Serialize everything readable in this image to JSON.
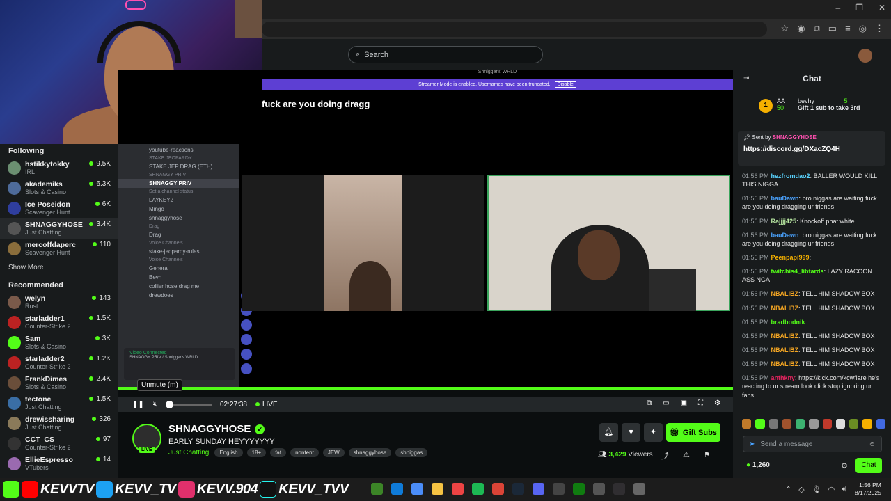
{
  "search": {
    "placeholder": "Search"
  },
  "sidebar": {
    "following_title": "Following",
    "following": [
      {
        "name": "hstikkytokky",
        "category": "IRL",
        "viewers": "9.5K",
        "color": "#6b8f71"
      },
      {
        "name": "akademiks",
        "category": "Slots & Casino",
        "viewers": "6.3K",
        "color": "#4e6b9a"
      },
      {
        "name": "Ice Poseidon",
        "category": "Scavenger Hunt",
        "viewers": "6K",
        "color": "#2f3e9e"
      },
      {
        "name": "SHNAGGYHOSE",
        "category": "Just Chatting",
        "viewers": "3.4K",
        "color": "#555"
      },
      {
        "name": "mercoffdaperc",
        "category": "Scavenger Hunt",
        "viewers": "110",
        "color": "#8a6d3b"
      }
    ],
    "show_more": "Show More",
    "recommended_title": "Recommended",
    "recommended": [
      {
        "name": "welyn",
        "category": "Rust",
        "viewers": "143",
        "color": "#7a5a4a"
      },
      {
        "name": "starladder1",
        "category": "Counter-Strike 2",
        "viewers": "1.5K",
        "color": "#b22"
      },
      {
        "name": "Sam",
        "category": "Slots & Casino",
        "viewers": "3K",
        "color": "#53fc18"
      },
      {
        "name": "starladder2",
        "category": "Counter-Strike 2",
        "viewers": "1.2K",
        "color": "#b22"
      },
      {
        "name": "FrankDimes",
        "category": "Slots & Casino",
        "viewers": "2.4K",
        "color": "#6a4e3a"
      },
      {
        "name": "tectone",
        "category": "Just Chatting",
        "viewers": "1.5K",
        "color": "#3a6ea5"
      },
      {
        "name": "drewissharing",
        "category": "Just Chatting",
        "viewers": "326",
        "color": "#8a7a5a"
      },
      {
        "name": "CCT_CS",
        "category": "Counter-Strike 2",
        "viewers": "97",
        "color": "#333"
      },
      {
        "name": "EllieEspresso",
        "category": "VTubers",
        "viewers": "14",
        "color": "#9a6ab0"
      }
    ]
  },
  "discord": {
    "window_title": "Shnigger's WRLD",
    "streamer_mode": "Streamer Mode is enabled. Usernames have been truncated.",
    "disable": "Disable",
    "channels": [
      {
        "text": "youtube-reactions",
        "kind": "channel"
      },
      {
        "text": "STAKE JEOPARDY",
        "kind": "cat"
      },
      {
        "text": "STAKE JEP DRAG (ETH)",
        "kind": "channel"
      },
      {
        "text": "SHNAGGY PRIV",
        "kind": "cat"
      },
      {
        "text": "SHNAGGY PRIV",
        "kind": "hl"
      },
      {
        "text": "Set a channel status",
        "kind": "cat"
      },
      {
        "text": "LAYKEY2",
        "kind": "channel"
      },
      {
        "text": "Mingo",
        "kind": "channel"
      },
      {
        "text": "shnaggyhose",
        "kind": "channel"
      },
      {
        "text": "Drag",
        "kind": "cat"
      },
      {
        "text": "Drag",
        "kind": "channel"
      },
      {
        "text": "Voice Channels",
        "kind": "cat"
      },
      {
        "text": "stake-jeopardy-rules",
        "kind": "channel"
      },
      {
        "text": "Voice Channels",
        "kind": "cat"
      },
      {
        "text": "General",
        "kind": "channel"
      },
      {
        "text": "Bevh",
        "kind": "channel"
      },
      {
        "text": "collier hose drag me",
        "kind": "channel"
      },
      {
        "text": "drewdoes",
        "kind": "channel"
      }
    ],
    "voice_status": "Video Connected",
    "voice_sub": "SHNAGGY PRIV / Shnigger's WRLD"
  },
  "video": {
    "caption": "fuck are you doing dragg",
    "tooltip": "Unmute (m)",
    "time": "02:27:38",
    "live": "LIVE"
  },
  "channel": {
    "name": "SHNAGGYHOSE",
    "title": "EARLY SUNDAY HEYYYYYYY",
    "live_badge": "LIVE",
    "category": "Just Chatting",
    "tags": [
      "English",
      "18+",
      "fat",
      "nontent",
      "JEW",
      "shnaggyhose",
      "shniggas"
    ],
    "gift_subs": "Gift Subs",
    "viewers": "3,429",
    "viewers_label": "Viewers"
  },
  "chat": {
    "title": "Chat",
    "leader_rank": "1",
    "leader_user": "AA",
    "leader_count": "50",
    "leader_user2": "bevhy",
    "leader_count2": "5",
    "leader_cta": "Gift 1 sub to take 3rd",
    "pinned_label": "Sent by",
    "pinned_sender": "SHNAGGYHOSE",
    "pinned_link": "https://discord.gg/DXacZQ4H",
    "messages": [
      {
        "time": "01:56 PM",
        "user": "hezfromdao2",
        "color": "#5ad4ff",
        "text": "BALLER WOULD KILL THIS NIGGA"
      },
      {
        "time": "01:56 PM",
        "user": "bauDawn",
        "color": "#4aa3ff",
        "text": "bro niggas are waiting fuck are you doing dragging ur friends"
      },
      {
        "time": "01:56 PM",
        "user": "Rajjjj425",
        "color": "#b6e5a0",
        "text": "Knockoff phat white."
      },
      {
        "time": "01:56 PM",
        "user": "bauDawn",
        "color": "#4aa3ff",
        "text": "bro niggas are waiting fuck are you doing dragging ur friends"
      },
      {
        "time": "01:56 PM",
        "user": "Peenpapi999",
        "color": "#f5b000",
        "text": ""
      },
      {
        "time": "01:56 PM",
        "user": "twitchis4_libtards",
        "color": "#53fc18",
        "text": "LAZY RACOON ASS NGA"
      },
      {
        "time": "01:56 PM",
        "user": "NBALIBZ",
        "color": "#f5a623",
        "text": "TELL HIM SHADOW BOX"
      },
      {
        "time": "01:56 PM",
        "user": "NBALIBZ",
        "color": "#f5a623",
        "text": "TELL HIM SHADOW BOX"
      },
      {
        "time": "01:56 PM",
        "user": "bradbodnik",
        "color": "#53fc18",
        "text": ""
      },
      {
        "time": "01:56 PM",
        "user": "NBALIBZ",
        "color": "#f5a623",
        "text": "TELL HIM SHADOW BOX"
      },
      {
        "time": "01:56 PM",
        "user": "NBALIBZ",
        "color": "#f5a623",
        "text": "TELL HIM SHADOW BOX"
      },
      {
        "time": "01:56 PM",
        "user": "NBALIBZ",
        "color": "#f5a623",
        "text": "TELL HIM SHADOW BOX"
      },
      {
        "time": "01:56 PM",
        "user": "anthkny",
        "color": "#e0245e",
        "text": "https://kick.com/kcwflare he's reacting to ur stream look click stop ignoring ur fans"
      }
    ],
    "input_placeholder": "Send a message",
    "points": "1,260",
    "chat_button": "Chat"
  },
  "overlay": {
    "handle1": "KEVVTV",
    "handle2": "KEVV_TV",
    "handle3": "KEVV.904",
    "handle4": "KEVV_TVV"
  },
  "taskbar": {
    "time": "1:56 PM",
    "date": "8/17/2025"
  }
}
